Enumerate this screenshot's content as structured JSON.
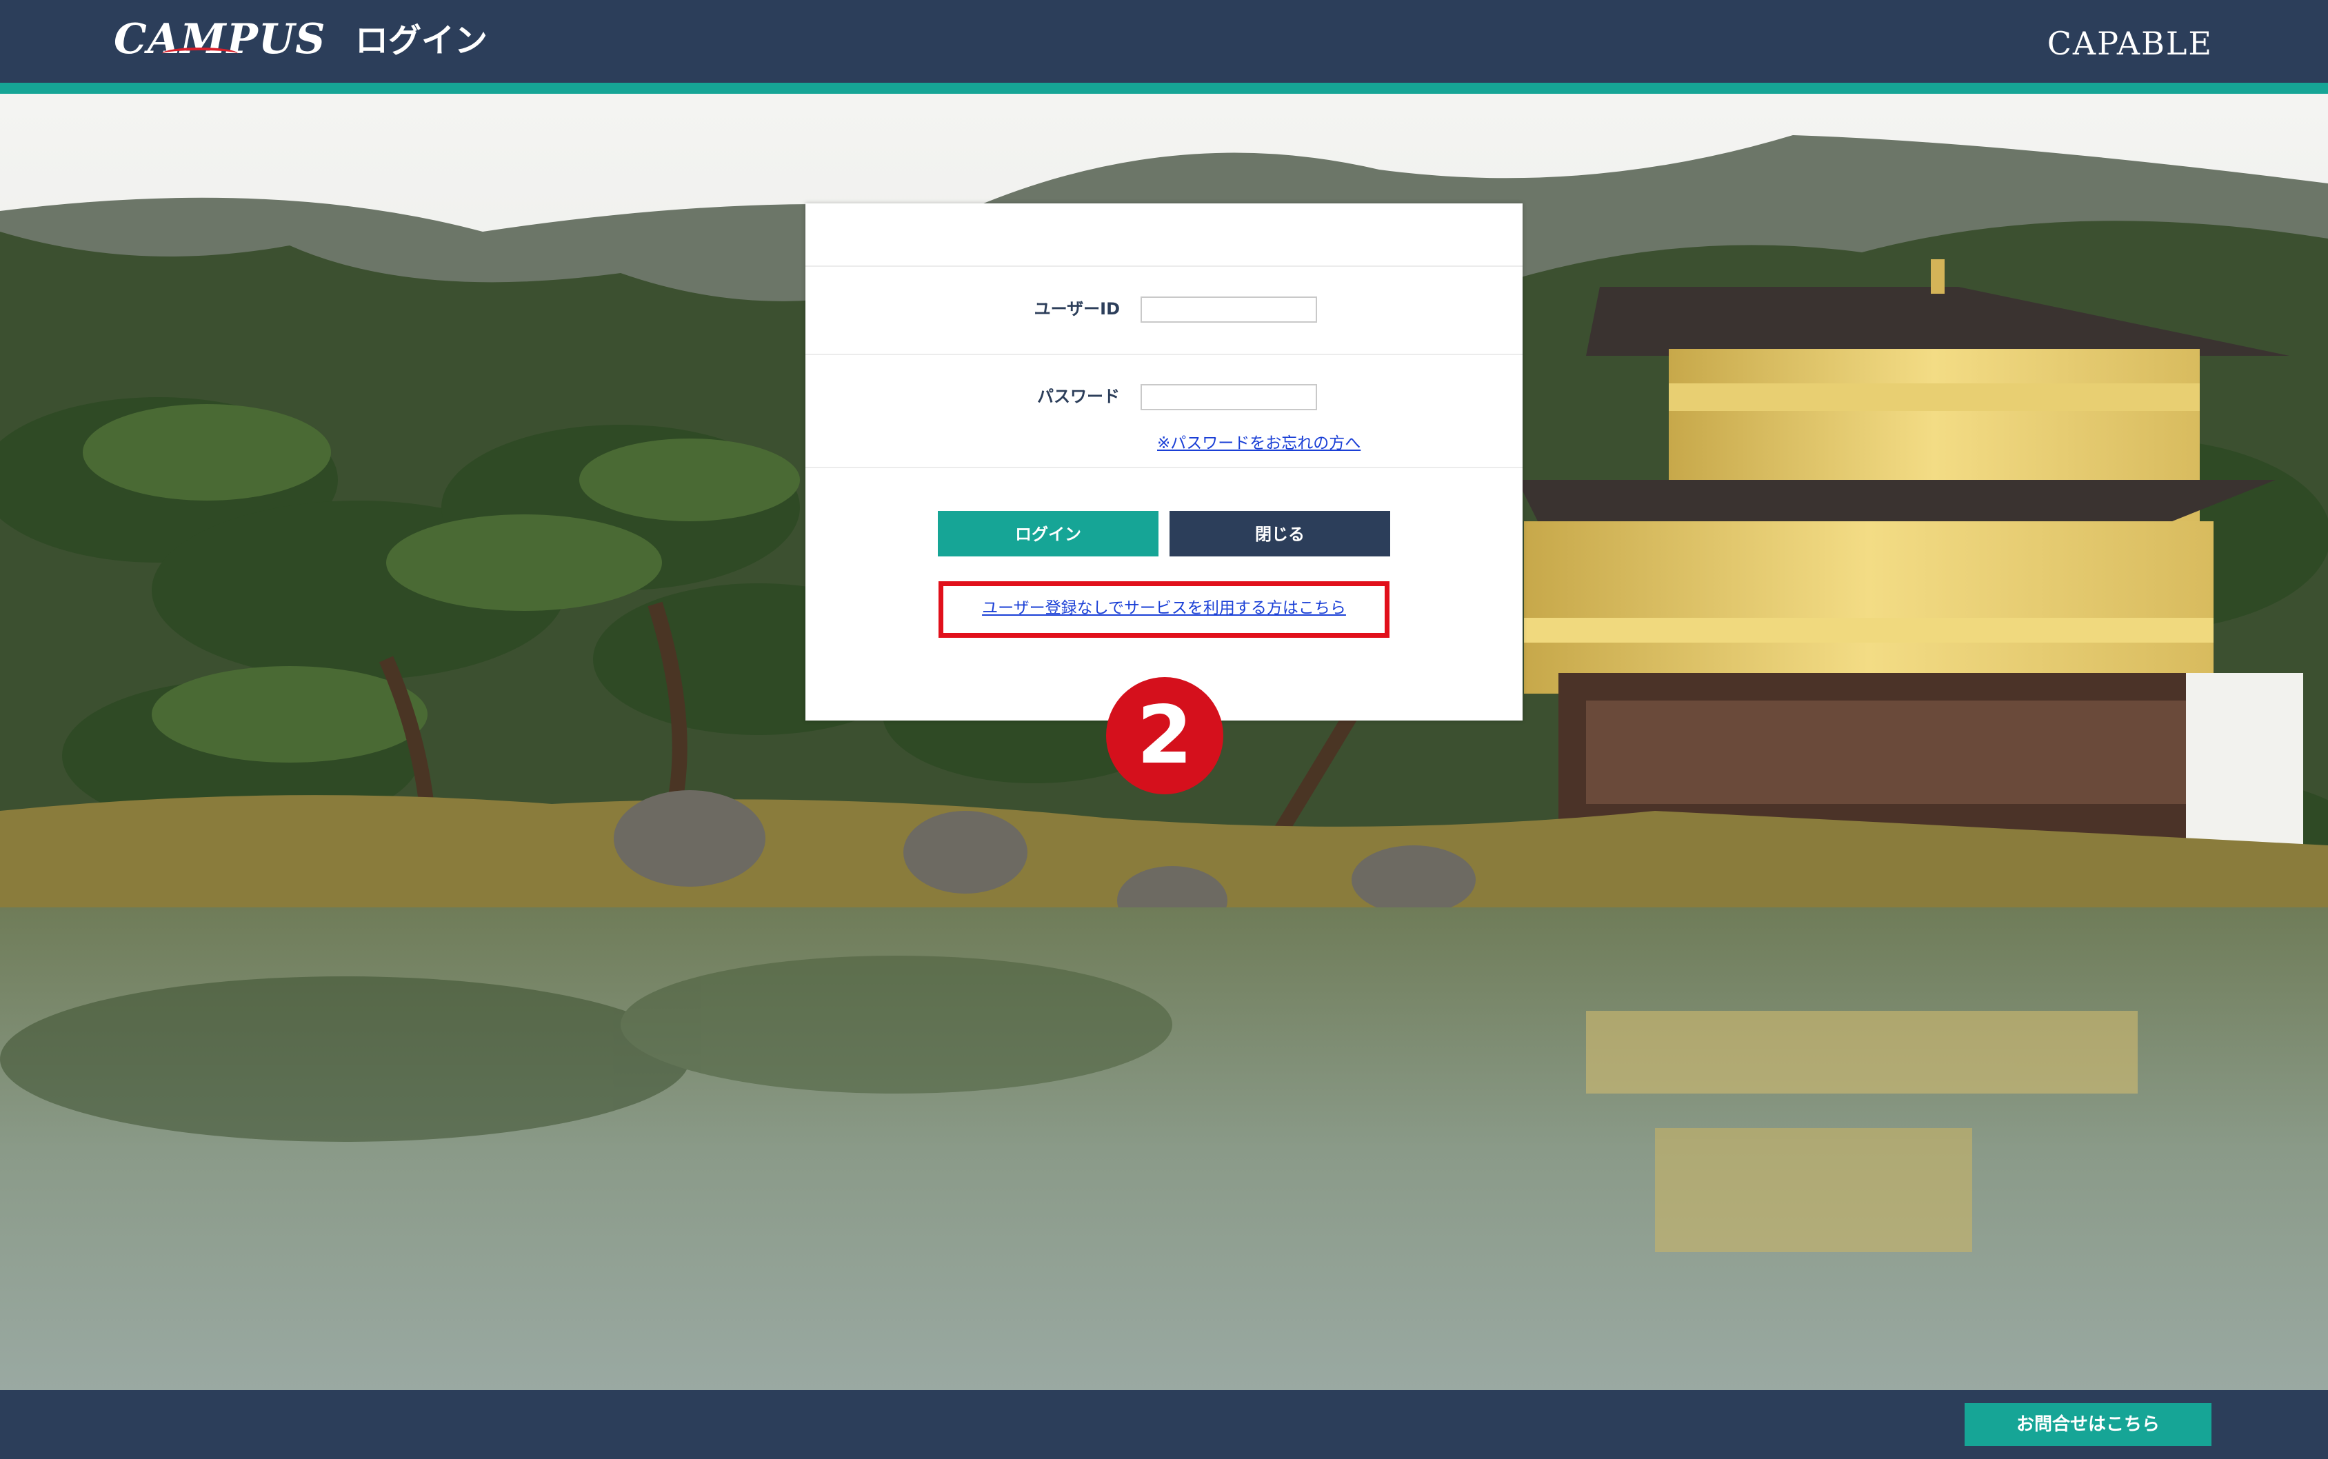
{
  "header": {
    "logo_left": "CAMPUS",
    "title": "ログイン",
    "logo_right": "CAPABLE"
  },
  "login_form": {
    "user_id_label": "ユーザーID",
    "user_id_value": "",
    "password_label": "パスワード",
    "password_value": "",
    "forgot_password_link": "※パスワードをお忘れの方へ",
    "login_button": "ログイン",
    "close_button": "閉じる",
    "guest_link": "ユーザー登録なしでサービスを利用する方はこちら"
  },
  "annotation": {
    "step_number": "2",
    "highlight_color": "#e1101b"
  },
  "footer": {
    "contact_button": "お問合せはこちら"
  },
  "colors": {
    "navy": "#2c3e5a",
    "teal": "#16a596",
    "link_blue": "#1a3fd6"
  },
  "background_image": "Golden pavilion temple beside a reflecting pond with pine trees and hills"
}
